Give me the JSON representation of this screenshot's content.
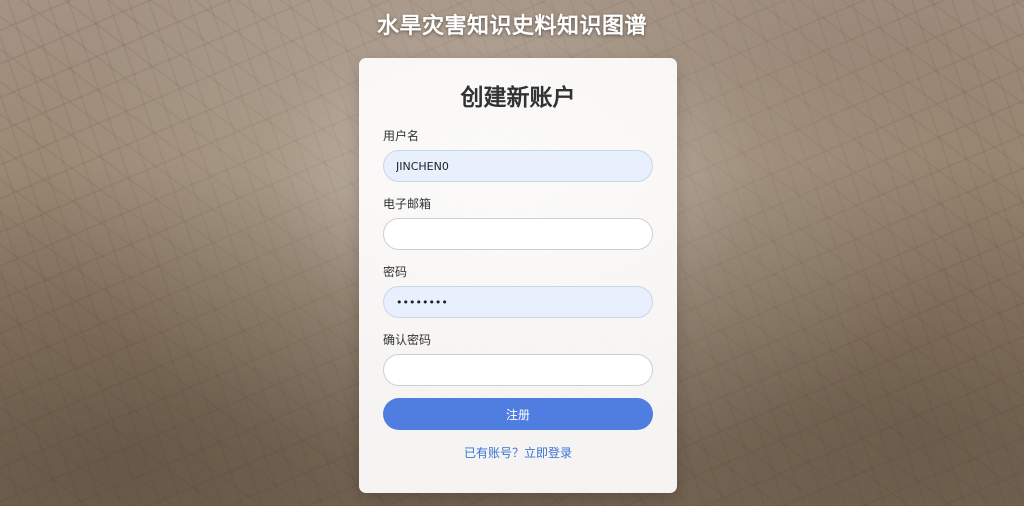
{
  "page": {
    "title": "水旱灾害知识史料知识图谱"
  },
  "form": {
    "title": "创建新账户",
    "username": {
      "label": "用户名",
      "value": "JINCHEN0"
    },
    "email": {
      "label": "电子邮箱",
      "value": ""
    },
    "password": {
      "label": "密码",
      "value": "password"
    },
    "confirm_password": {
      "label": "确认密码",
      "value": ""
    },
    "submit_label": "注册",
    "login_link": "已有账号？立即登录"
  },
  "colors": {
    "accent": "#4f7de0",
    "link": "#3a72d8",
    "autofill": "#e8f0fe"
  }
}
